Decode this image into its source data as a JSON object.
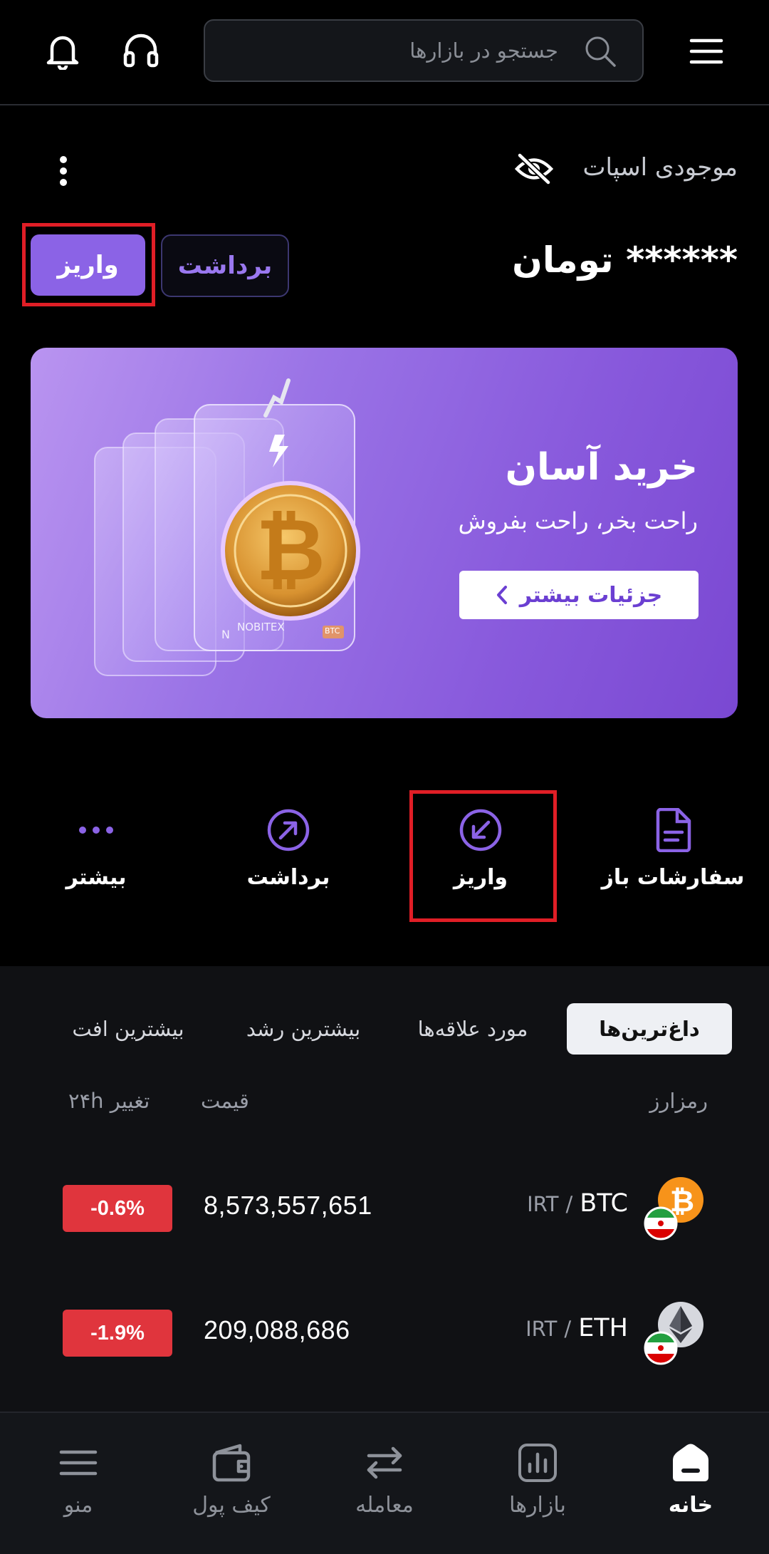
{
  "header": {
    "search_placeholder": "جستجو در بازارها",
    "icons": [
      "hamburger-icon",
      "search-icon",
      "headset-icon",
      "bell-icon"
    ]
  },
  "balance": {
    "label": "موجودی اسپات",
    "amount": "****** تومان",
    "deposit_label": "واریز",
    "withdraw_label": "برداشت",
    "icons": [
      "eye-off-icon",
      "more-vertical-icon"
    ]
  },
  "banner": {
    "title": "خرید آسان",
    "subtitle": "راحت بخر، راحت بفروش",
    "button_label": "جزئیات بیشتر",
    "card_brand": "NOBITEX",
    "card_tag": "BTC"
  },
  "quick_actions": [
    {
      "label": "سفارشات باز",
      "icon": "document-icon"
    },
    {
      "label": "واریز",
      "icon": "deposit-arrow-icon"
    },
    {
      "label": "برداشت",
      "icon": "withdraw-arrow-icon"
    },
    {
      "label": "بیشتر",
      "icon": "more-dots-icon"
    }
  ],
  "market": {
    "tabs": [
      "داغ‌ترین‌ها",
      "مورد علاقه‌ها",
      "بیشترین رشد",
      "بیشترین افت"
    ],
    "active_tab": "داغ‌ترین‌ها",
    "columns": {
      "asset": "رمزارز",
      "price": "قیمت",
      "change": "تغییر ۲۴h"
    },
    "rows": [
      {
        "base": "BTC",
        "separator": "/",
        "quote": "IRT",
        "price": "8,573,557,651",
        "change": "-0.6%"
      },
      {
        "base": "ETH",
        "separator": "/",
        "quote": "IRT",
        "price": "209,088,686",
        "change": "-1.9%"
      }
    ]
  },
  "bottom_nav": [
    {
      "label": "خانه",
      "icon": "home-icon",
      "active": true
    },
    {
      "label": "بازارها",
      "icon": "chart-icon",
      "active": false
    },
    {
      "label": "معامله",
      "icon": "swap-icon",
      "active": false
    },
    {
      "label": "کیف پول",
      "icon": "wallet-icon",
      "active": false
    },
    {
      "label": "منو",
      "icon": "menu-icon",
      "active": false
    }
  ],
  "colors": {
    "accent": "#8b63e6",
    "negative": "#e0353d",
    "highlight": "#e01e26"
  }
}
